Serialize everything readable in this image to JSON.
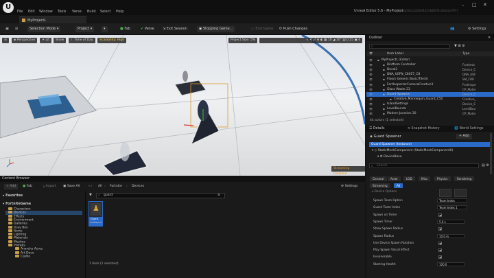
{
  "app": {
    "title": "Unreal Editor 5.6 - MyProject",
    "title_suffix": "[lb4b20ac2dd56f4d218d85f3cd0a42e797]",
    "project_tab": "MyProjectL"
  },
  "menu": [
    "File",
    "Edit",
    "Window",
    "Tools",
    "Verse",
    "Build",
    "Select",
    "Help"
  ],
  "toolbar": {
    "mode": "Selection Mode",
    "project": "Project",
    "fab": "Fab",
    "verse": "Verse",
    "exit_session": "Exit Session",
    "stopping_game": "Stopping Game...",
    "end_game": "End Game",
    "push_changes": "Push Changes",
    "settings": "Settings"
  },
  "viewport": {
    "perspective": "Perspective",
    "lit": "Lit",
    "show": "Show",
    "time_of_day": "Time of Day",
    "scalability": "Scalability: High",
    "project_size": "Project Size: 5%",
    "streaming": "Streaming Disabled"
  },
  "content_browser": {
    "tab": "Content Browser",
    "add": "+ Add",
    "fab": "Fab",
    "import": "Import",
    "save_all": "Save All",
    "breadcrumb": [
      "All",
      "Fortnite",
      "Devices"
    ],
    "search_value": "guard",
    "settings": "Settings",
    "favorites": "Favorites",
    "root": "FortniteGame",
    "folders": [
      "Characters",
      "Devices",
      "Effects",
      "Environment",
      "Galleries",
      "Gray Box",
      "Items",
      "Lighting",
      "Materials",
      "Meshes",
      "Prefabs"
    ],
    "subfolders": [
      "Anarchy Acres",
      "Art Deco",
      "Castle"
    ],
    "asset_label": "Guard",
    "asset_sub": "FortPlayerS",
    "status": "1 item (1 selected)"
  },
  "outliner": {
    "tab": "Outliner",
    "col_label": "Item Label",
    "col_type": "Type",
    "rows": [
      {
        "label": "MyProjectL (Editor)",
        "type": "",
        "selected": false
      },
      {
        "label": "Birdfrom Controller",
        "type": "FortAmb",
        "selected": false
      },
      {
        "label": "Decal2",
        "type": "Device_C",
        "selected": false
      },
      {
        "label": "DNA_UEFN_C8057_C8",
        "type": "DNA_UEF",
        "selected": false
      },
      {
        "label": "Floors Generic Basic/Tile34",
        "type": "SM_FOR",
        "selected": false
      },
      {
        "label": "FortInspectorCameraCreative1",
        "type": "FortInspe",
        "selected": false
      },
      {
        "label": "Glass Waste 23",
        "type": "CP_Mater",
        "selected": false
      },
      {
        "label": "Guard Spawner",
        "type": "Device_C",
        "selected": true
      },
      {
        "label": "Creative_Mannequin_Guard_C50",
        "type": "Creative_",
        "selected": false
      },
      {
        "label": "IslandSettings",
        "type": "Device_C",
        "selected": false
      },
      {
        "label": "LevelBounds",
        "type": "LevelBou",
        "selected": false
      },
      {
        "label": "Modern Junction 20",
        "type": "CP_Mater",
        "selected": false
      }
    ],
    "status": "44 actors (1 selected)"
  },
  "details": {
    "tab": "Details",
    "snapshot_tab": "Snapshot History",
    "world_tab": "World Settings",
    "object": "Guard Spawner",
    "add": "+ Add",
    "instance": "Guard Spawner (Instance)",
    "component": "StaticMeshComponent (StaticMeshComponent0)",
    "sub": "DeviceBase",
    "search_placeholder": "Search",
    "filter_tabs": [
      "General",
      "Actor",
      "LOD",
      "Misc",
      "Physics",
      "Rendering",
      "Streaming",
      "All"
    ],
    "section": "Device Options",
    "props": [
      {
        "label": "Spawn Team Option",
        "value": "Team Index",
        "kind": "select"
      },
      {
        "label": "Guard Team Index",
        "value": "Team Index   1",
        "kind": "select"
      },
      {
        "label": "Spawn on Timer",
        "value": "",
        "kind": "check"
      },
      {
        "label": "Spawn Timer",
        "value": "5.0 s",
        "kind": "field"
      },
      {
        "label": "Show Spawn Radius",
        "value": "",
        "kind": "check"
      },
      {
        "label": "Spawn Radius",
        "value": "10.0 m",
        "kind": "field"
      },
      {
        "label": "Use Device Spawn Rotation",
        "value": "",
        "kind": "check"
      },
      {
        "label": "Play Spawn Visual Effect",
        "value": "",
        "kind": "check"
      },
      {
        "label": "Invulnerable",
        "value": "",
        "kind": "check"
      },
      {
        "label": "Starting Health",
        "value": "100.0",
        "kind": "field"
      }
    ]
  },
  "colors": {
    "accent": "#2a6ac9",
    "selection": "#e09a2b",
    "fab_green": "#4caf50"
  }
}
